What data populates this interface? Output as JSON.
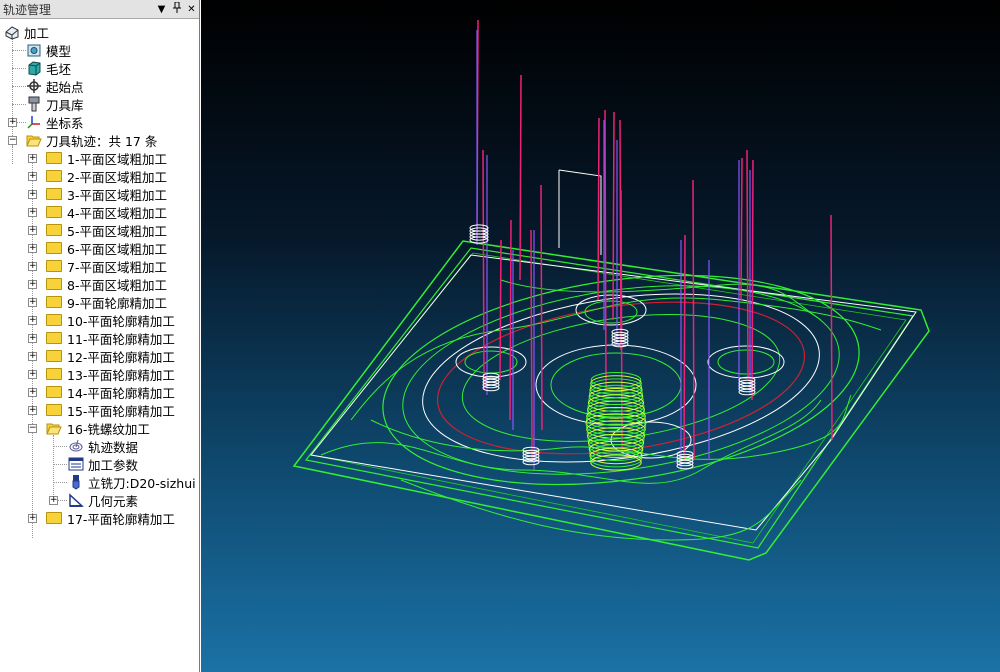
{
  "panel": {
    "title": "轨迹管理",
    "buttons": {
      "dropdown": "▼",
      "pin": "ᚓ",
      "close": "✕"
    }
  },
  "tree": {
    "root": "加工",
    "model": "模型",
    "blank": "毛坯",
    "start_point": "起始点",
    "tool_library": "刀具库",
    "coord_system": "坐标系",
    "toolpaths_header": "刀具轨迹：共 17 条",
    "paths": [
      "1-平面区域粗加工",
      "2-平面区域粗加工",
      "3-平面区域粗加工",
      "4-平面区域粗加工",
      "5-平面区域粗加工",
      "6-平面区域粗加工",
      "7-平面区域粗加工",
      "8-平面区域粗加工",
      "9-平面轮廓精加工",
      "10-平面轮廓精加工",
      "11-平面轮廓精加工",
      "12-平面轮廓精加工",
      "13-平面轮廓精加工",
      "14-平面轮廓精加工",
      "15-平面轮廓精加工",
      "16-铣螺纹加工"
    ],
    "path16_children": {
      "path_data": "轨迹数据",
      "params": "加工参数",
      "tool": "立铣刀:D20-sizhui",
      "geometry": "几何元素"
    },
    "path17": "17-平面轮廓精加工"
  },
  "viewport": {
    "colors": {
      "toolpath": "#33ee33",
      "rapid": "#ee2277",
      "plunge": "#8855ff",
      "outline": "#ffffff",
      "circle": "#cc2233"
    }
  }
}
